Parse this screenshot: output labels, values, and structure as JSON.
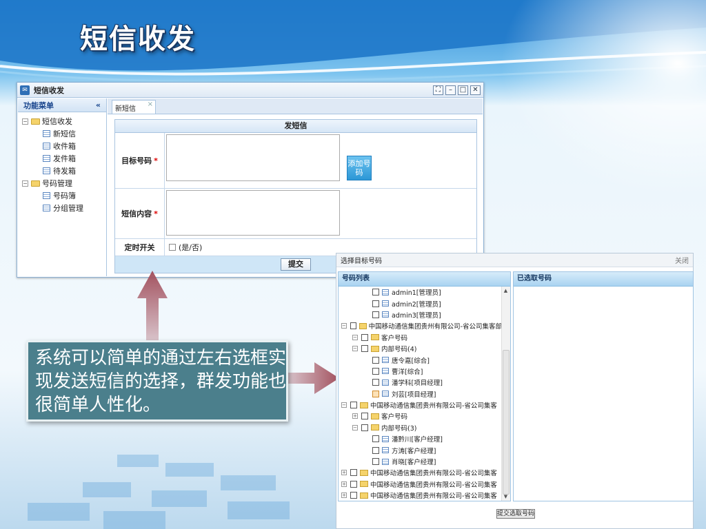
{
  "slide": {
    "title": "短信收发",
    "caption": "系统可以简单的通过左右选框实现发送短信的选择，群发功能也很简单人性化。"
  },
  "window": {
    "title": "短信收发",
    "sidebar": {
      "header": "功能菜单",
      "collapse_glyph": "«",
      "groups": [
        {
          "label": "短信收发",
          "expanded": true,
          "items": [
            "新短信",
            "收件箱",
            "发件箱",
            "待发箱"
          ]
        },
        {
          "label": "号码管理",
          "expanded": true,
          "items": [
            "号码簿",
            "分组管理"
          ]
        }
      ]
    },
    "tab": {
      "label": "新短信",
      "close_glyph": "×"
    },
    "form": {
      "title": "发短信",
      "target_label": "目标号码",
      "content_label": "短信内容",
      "required_mark": "*",
      "add_button": "添加号码",
      "timer_label": "定时开关",
      "timer_option": "(是/否)",
      "submit": "提交"
    }
  },
  "dialog": {
    "title": "选择目标号码",
    "close": "关闭",
    "left_header": "号码列表",
    "right_header": "已选取号码",
    "submit": "提交选取号码",
    "list": [
      {
        "indent": 2,
        "type": "leaf",
        "text": "admin1[管理员]"
      },
      {
        "indent": 2,
        "type": "leaf",
        "text": "admin2[管理员]"
      },
      {
        "indent": 2,
        "type": "leaf",
        "text": "admin3[管理员]"
      },
      {
        "indent": 0,
        "type": "folder",
        "exp": "⊟",
        "text": "中国移动通信集团贵州有限公司-省公司集客部"
      },
      {
        "indent": 1,
        "type": "folder",
        "exp": "⊟",
        "text": "客户号码"
      },
      {
        "indent": 1,
        "type": "folder",
        "exp": "⊟",
        "text": "内部号码(4)"
      },
      {
        "indent": 2,
        "type": "leaf",
        "text": "唐令嘉[综合]"
      },
      {
        "indent": 2,
        "type": "leaf",
        "text": "曹洋[综合]"
      },
      {
        "indent": 2,
        "type": "leaf",
        "text": "潘学科[项目经理]"
      },
      {
        "indent": 2,
        "type": "leaf",
        "text": "刘芸[项目经理]",
        "highlight": true
      },
      {
        "indent": 0,
        "type": "folder",
        "exp": "⊟",
        "text": "中国移动通信集团贵州有限公司-省公司集客"
      },
      {
        "indent": 1,
        "type": "folder",
        "exp": "⊞",
        "text": "客户号码"
      },
      {
        "indent": 1,
        "type": "folder",
        "exp": "⊟",
        "text": "内部号码(3)"
      },
      {
        "indent": 2,
        "type": "leaf",
        "text": "潘黔川[客户经理]"
      },
      {
        "indent": 2,
        "type": "leaf",
        "text": "方涛[客户经理]"
      },
      {
        "indent": 2,
        "type": "leaf",
        "text": "肖晓[客户经理]"
      },
      {
        "indent": 0,
        "type": "folder",
        "exp": "⊞",
        "text": "中国移动通信集团贵州有限公司-省公司集客"
      },
      {
        "indent": 0,
        "type": "folder",
        "exp": "⊞",
        "text": "中国移动通信集团贵州有限公司-省公司集客"
      },
      {
        "indent": 0,
        "type": "folder",
        "exp": "⊞",
        "text": "中国移动通信集团贵州有限公司-省公司集客"
      }
    ]
  },
  "colors": {
    "caption_bg": "#4b7f8c",
    "arrow": "#9e5a66",
    "panel_header": "#a9d3f1"
  }
}
